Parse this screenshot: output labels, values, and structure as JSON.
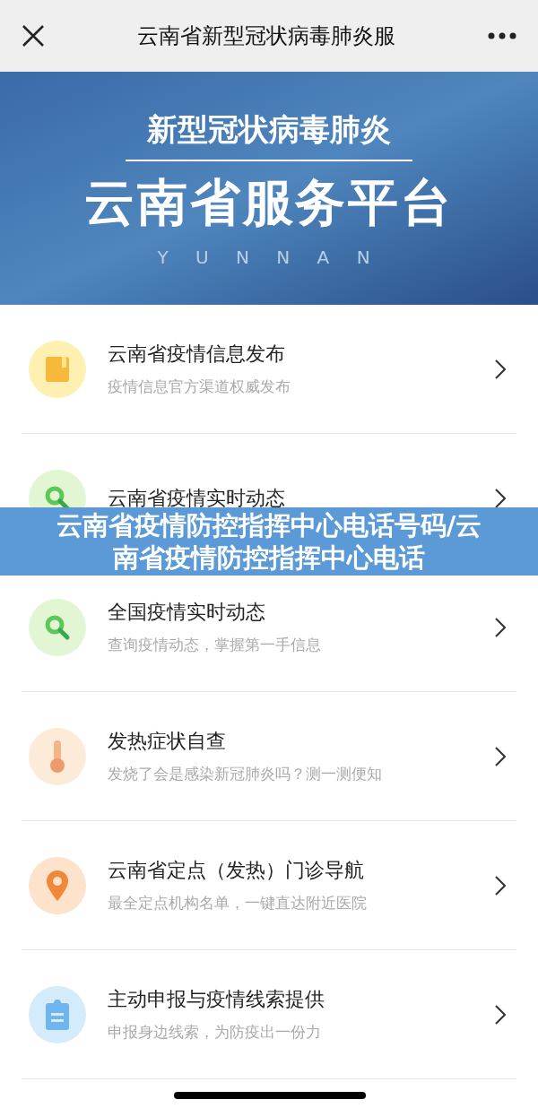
{
  "nav_bar": {
    "title": "云南省新型冠状病毒肺炎服"
  },
  "hero_banner": {
    "subtitle": "新型冠状病毒肺炎",
    "title": "云南省服务平台",
    "caption": "Y U N N A N"
  },
  "menu_items": [
    {
      "kind": "book",
      "title": "云南省疫情信息发布",
      "subtitle": "疫情信息官方渠道权威发布"
    },
    {
      "kind": "search",
      "title": "云南省疫情实时动态"
    },
    {
      "kind": "search",
      "title": "全国疫情实时动态",
      "subtitle": "查询疫情动态，掌握第一手信息"
    },
    {
      "kind": "thermometer",
      "title": "发热症状自查",
      "subtitle": "发烧了会是感染新冠肺炎吗？测一测便知"
    },
    {
      "kind": "pin",
      "title": "云南省定点（发热）门诊导航",
      "subtitle": "最全定点机构名单，一键直达附近医院"
    },
    {
      "kind": "clipboard",
      "title": "主动申报与疫情线索提供",
      "subtitle": "申报身边线索，为防疫出一份力"
    }
  ],
  "overlay_caption": "云南省疫情防控指挥中心电话号码/云南省疫情防控指挥中心电话"
}
